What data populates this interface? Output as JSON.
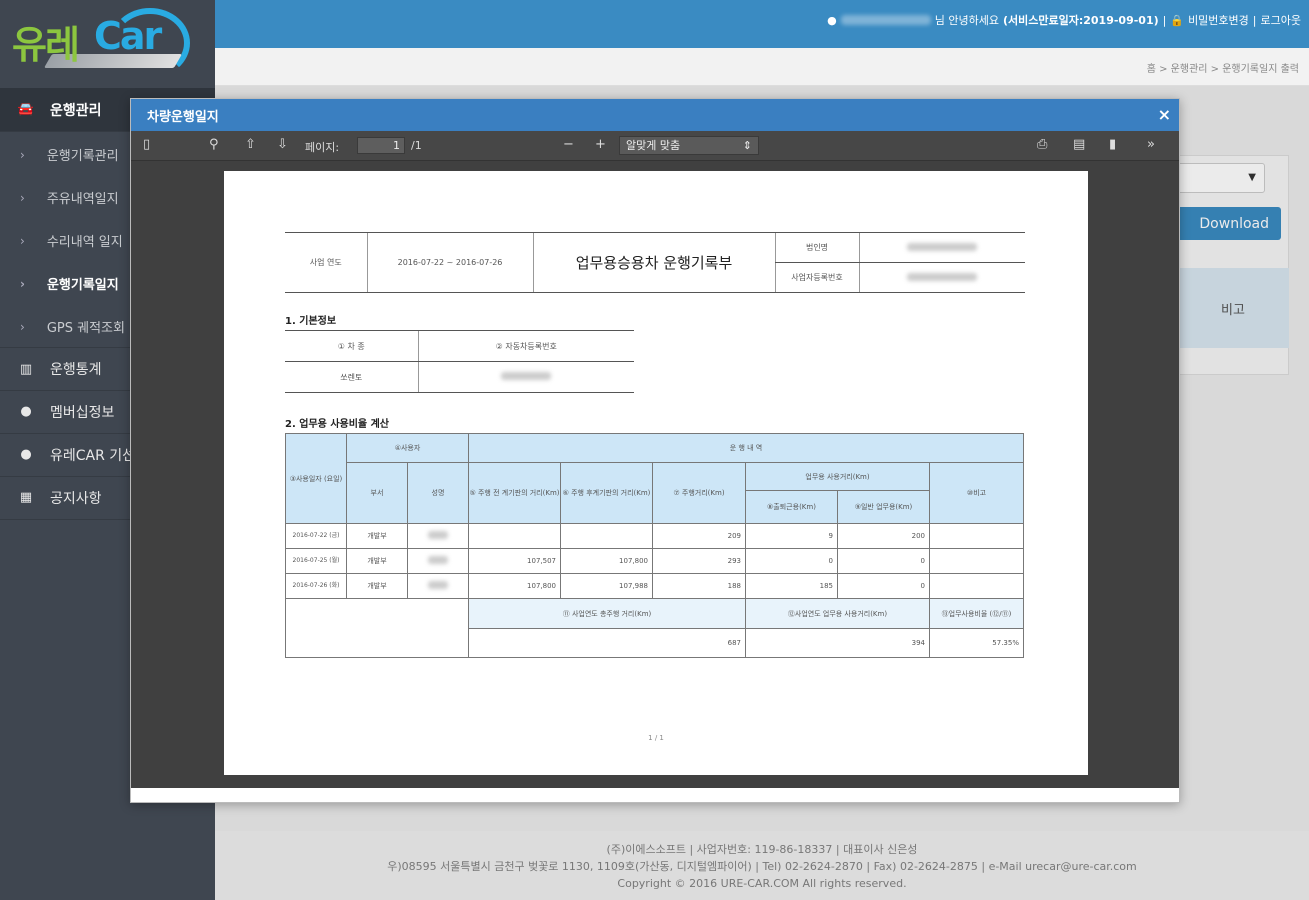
{
  "brand": {
    "logo_left": "유레",
    "logo_right": "Car"
  },
  "header": {
    "greeting": "님 안녕하세요",
    "service_period": "(서비스만료일자:2019-09-01)",
    "change_password": "비밀번호변경",
    "logout": "로그아웃",
    "separator": "|"
  },
  "breadcrumb": "홈 > 운행관리 > 운행기록일지 출력",
  "sidebar": {
    "items": [
      {
        "label": "운행관리",
        "icon": "car-icon"
      },
      {
        "label": "운행기록관리"
      },
      {
        "label": "주유내역일지"
      },
      {
        "label": "수리내역 일지"
      },
      {
        "label": "운행기록일지"
      },
      {
        "label": "GPS 궤적조회"
      },
      {
        "label": "운행통계",
        "icon": "chart-icon"
      },
      {
        "label": "멤버십정보",
        "icon": "user-icon"
      },
      {
        "label": "유레CAR 기선",
        "icon": "user-icon"
      },
      {
        "label": "공지사항",
        "icon": "calendar-icon"
      }
    ]
  },
  "background": {
    "download_label": "Download",
    "remarks_header": "비고"
  },
  "modal": {
    "title": "차량운행일지",
    "close": "×"
  },
  "pdf_toolbar": {
    "page_label": "페이지:",
    "page_value": "1",
    "page_total": "/1",
    "zoom_out": "−",
    "zoom_in": "+",
    "zoom_select": "알맞게 맞춤"
  },
  "document": {
    "period_label": "사업 연도",
    "period_value": "2016-07-22 ~ 2016-07-26",
    "title": "업무용승용차 운행기록부",
    "corp_name_label": "법인명",
    "biz_no_label": "사업자등록번호",
    "basic_info_title": "1. 기본정보",
    "car_type_label": "① 차 종",
    "car_reg_label": "② 자동차등록번호",
    "car_type_value": "쏘렌토",
    "usage_title": "2. 업무용 사용비율 계산",
    "col_date": "③사용일자 (요일)",
    "col_user": "④사용자",
    "col_dept": "부서",
    "col_name": "성명",
    "col_log": "운 행 내 역",
    "col_before": "⑤ 주행 전 계기판의 거리(Km)",
    "col_after": "⑥ 주행 후계기판의 거리(Km)",
    "col_dist": "⑦ 주행거리(Km)",
    "col_biz": "업무용 사용거리(Km)",
    "col_commute": "⑧출퇴근용(Km)",
    "col_general": "⑨일반 업무용(Km)",
    "col_remark": "⑩비고",
    "rows": [
      {
        "date": "2016-07-22 (금)",
        "dept": "개발부",
        "before": "",
        "after": "",
        "dist": "209",
        "commute": "9",
        "general": "200"
      },
      {
        "date": "2016-07-25 (월)",
        "dept": "개발부",
        "before": "107,507",
        "after": "107,800",
        "dist": "293",
        "commute": "0",
        "general": "0"
      },
      {
        "date": "2016-07-26 (화)",
        "dept": "개발부",
        "before": "107,800",
        "after": "107,988",
        "dist": "188",
        "commute": "185",
        "general": "0"
      }
    ],
    "total_dist_label": "⑪ 사업연도 총주행 거리(Km)",
    "total_biz_label": "⑫사업연도 업무용 사용거리(Km)",
    "ratio_label": "⑬업무사용비율 (⑫/⑪)",
    "total_dist": "687",
    "total_biz": "394",
    "ratio": "57.35%",
    "page_footer": "1 / 1"
  },
  "footer": {
    "line1": "(주)이에스소프트 | 사업자번호: 119-86-18337 | 대표이사 신은성",
    "line2": "우)08595 서울특별시 금천구 벚꽃로 1130, 1109호(가산동, 디지털엠파이어) | Tel) 02-2624-2870 | Fax) 02-2624-2875 | e-Mail urecar@ure-car.com",
    "line3": "Copyright © 2016 URE-CAR.COM All rights reserved."
  }
}
